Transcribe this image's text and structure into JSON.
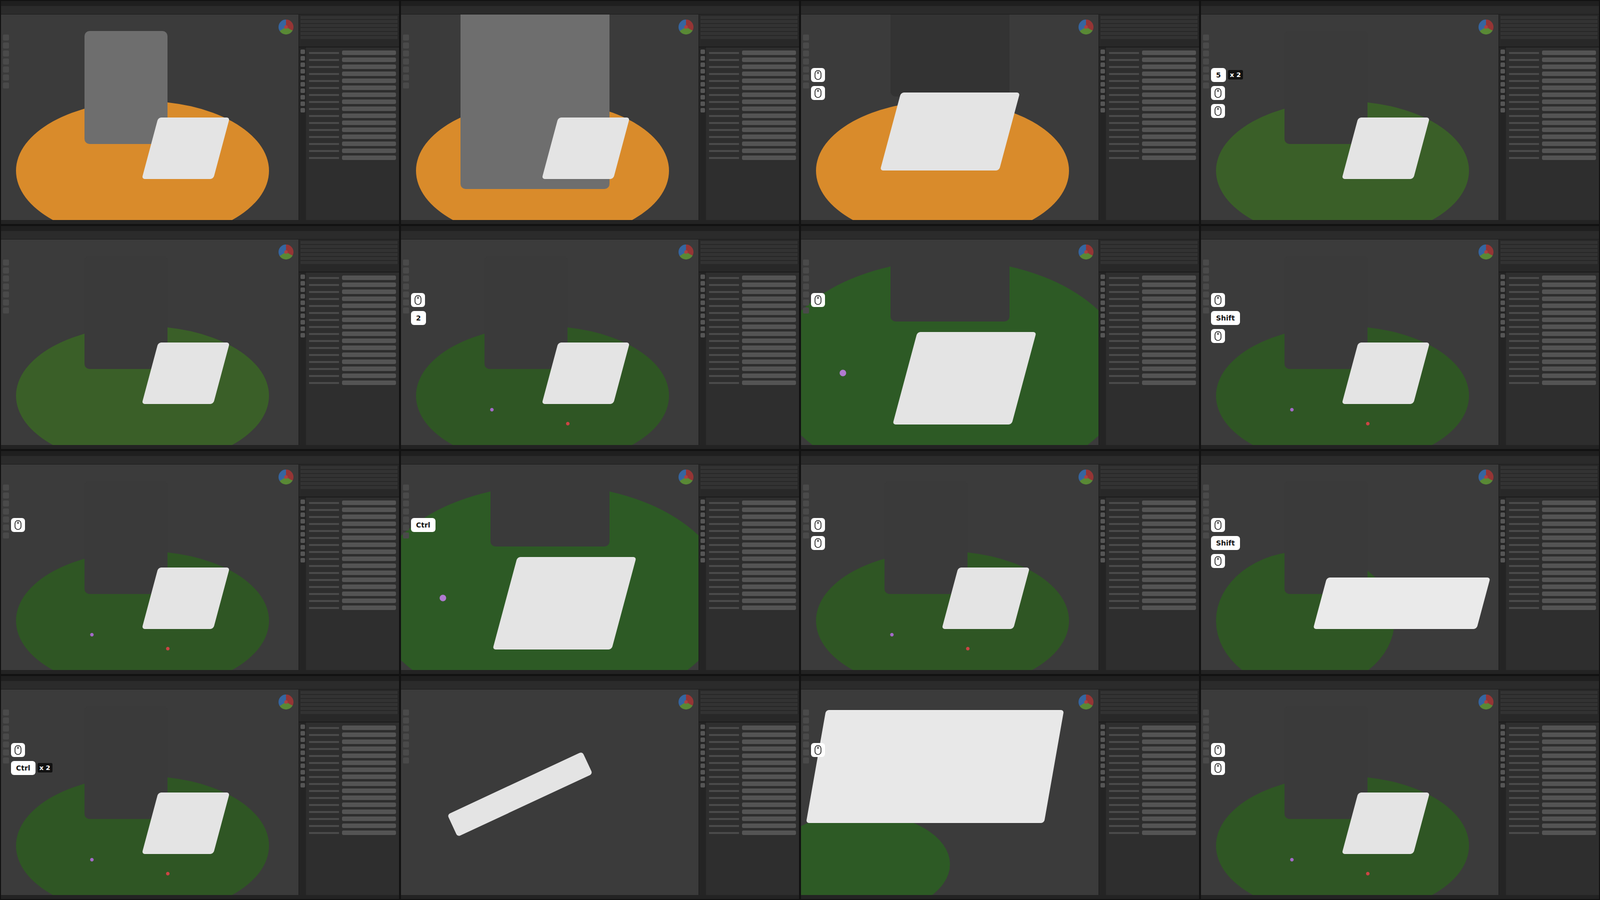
{
  "frames": [
    {
      "scene": "particles",
      "overlays": []
    },
    {
      "scene": "particles-close",
      "overlays": []
    },
    {
      "scene": "particles-stairs",
      "overlays": [
        {
          "kind": "mouse"
        },
        {
          "kind": "mouse"
        }
      ]
    },
    {
      "scene": "grass",
      "overlays": [
        {
          "kind": "key",
          "label": "5",
          "count": "x 2"
        },
        {
          "kind": "mouse"
        },
        {
          "kind": "mouse"
        }
      ]
    },
    {
      "scene": "grass",
      "overlays": []
    },
    {
      "scene": "flowers",
      "overlays": [
        {
          "kind": "mouse"
        },
        {
          "kind": "key",
          "label": "2",
          "count": ""
        }
      ]
    },
    {
      "scene": "flowers-close",
      "overlays": [
        {
          "kind": "mouse"
        }
      ]
    },
    {
      "scene": "flowers",
      "overlays": [
        {
          "kind": "mouse"
        },
        {
          "kind": "key",
          "label": "Shift",
          "count": ""
        },
        {
          "kind": "mouse"
        }
      ]
    },
    {
      "scene": "flowers",
      "overlays": [
        {
          "kind": "mouse"
        }
      ]
    },
    {
      "scene": "flowers-close",
      "overlays": [
        {
          "kind": "key",
          "label": "Ctrl",
          "count": ""
        }
      ]
    },
    {
      "scene": "flowers",
      "overlays": [
        {
          "kind": "mouse"
        },
        {
          "kind": "mouse"
        }
      ]
    },
    {
      "scene": "path",
      "overlays": [
        {
          "kind": "mouse"
        },
        {
          "kind": "key",
          "label": "Shift",
          "count": ""
        },
        {
          "kind": "mouse"
        }
      ]
    },
    {
      "scene": "flowers",
      "overlays": [
        {
          "kind": "mouse"
        },
        {
          "kind": "key",
          "label": "Ctrl",
          "count": "x 2"
        }
      ]
    },
    {
      "scene": "strip",
      "overlays": []
    },
    {
      "scene": "stone-close",
      "overlays": [
        {
          "kind": "mouse"
        }
      ]
    },
    {
      "scene": "flowers",
      "overlays": [
        {
          "kind": "mouse"
        },
        {
          "kind": "mouse"
        }
      ]
    }
  ]
}
